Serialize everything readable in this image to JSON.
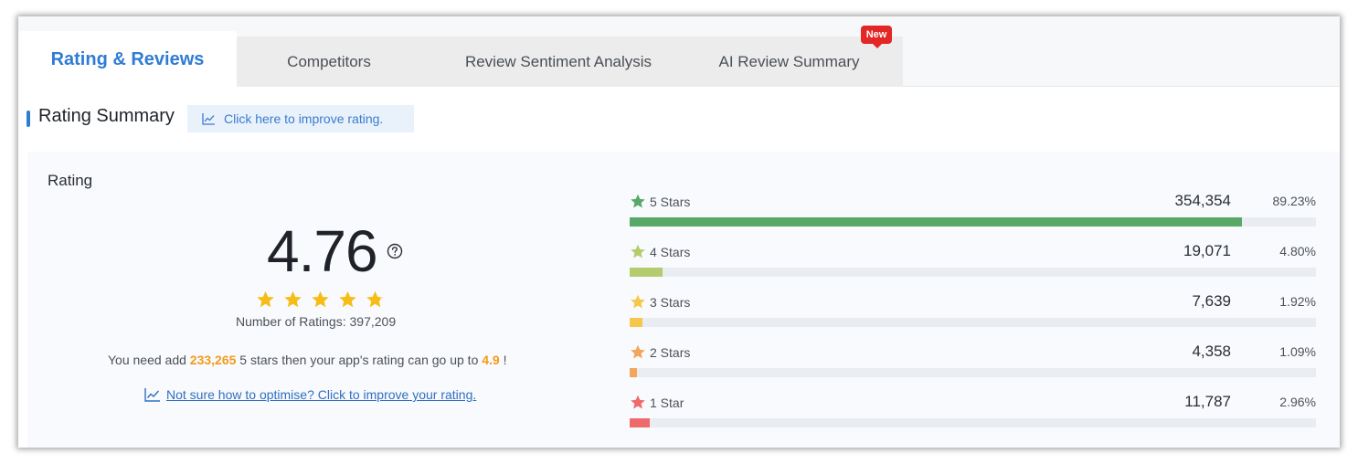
{
  "tabs": [
    {
      "label": "Rating & Reviews"
    },
    {
      "label": "Competitors"
    },
    {
      "label": "Review Sentiment Analysis"
    },
    {
      "label": "AI Review Summary",
      "badge": "New"
    }
  ],
  "summary": {
    "title": "Rating Summary",
    "improve_button": "Click here to improve rating."
  },
  "rating": {
    "label": "Rating",
    "score": "4.76",
    "stars_filled": 4.76,
    "num_ratings_text": "Number of Ratings: 397,209",
    "need_prefix": "You need add ",
    "need_count": "233,265",
    "need_middle": " 5 stars then your app's rating can go up to ",
    "need_target": "4.9",
    "need_suffix": " !",
    "optimise_link": "Not sure how to optimise? Click to improve your rating."
  },
  "distribution": [
    {
      "label": "5 Stars",
      "count": "354,354",
      "pct": "89.23%",
      "fraction": 0.8923,
      "color": "#58a868"
    },
    {
      "label": "4 Stars",
      "count": "19,071",
      "pct": "4.80%",
      "fraction": 0.048,
      "color": "#b5cc6e"
    },
    {
      "label": "3 Stars",
      "count": "7,639",
      "pct": "1.92%",
      "fraction": 0.0192,
      "color": "#f5c84b"
    },
    {
      "label": "2 Stars",
      "count": "4,358",
      "pct": "1.09%",
      "fraction": 0.0109,
      "color": "#f2a65a"
    },
    {
      "label": "1 Star",
      "count": "11,787",
      "pct": "2.96%",
      "fraction": 0.0296,
      "color": "#ef6b6b"
    }
  ],
  "colors": {
    "accent": "#2f7cd6",
    "star_gold": "#f6bd16",
    "highlight_orange": "#f39a1c"
  }
}
